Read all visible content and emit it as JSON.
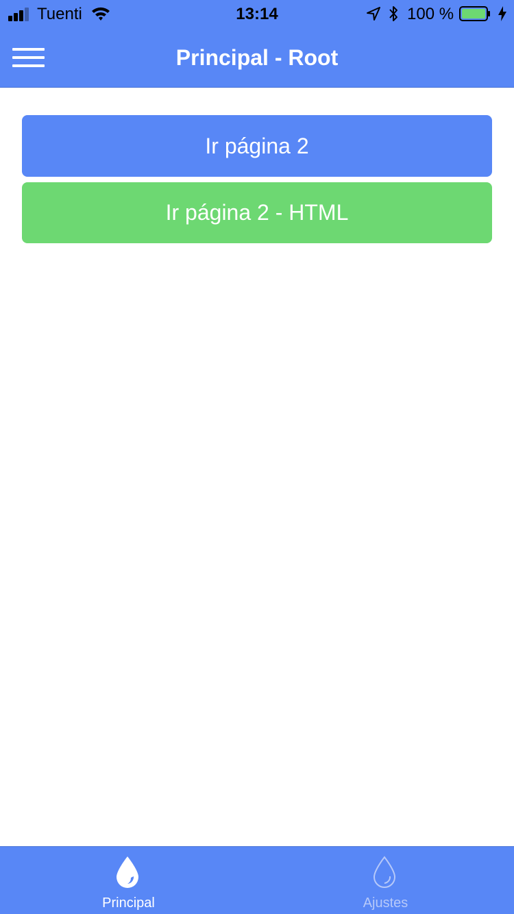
{
  "status_bar": {
    "carrier": "Tuenti",
    "time": "13:14",
    "battery_percent": "100 %"
  },
  "nav_bar": {
    "title": "Principal - Root",
    "menu_icon": "hamburger-icon"
  },
  "buttons": {
    "page2_label": "Ir página 2",
    "page2_html_label": "Ir página 2 - HTML"
  },
  "tab_bar": {
    "tabs": [
      {
        "label": "Principal",
        "icon": "water-drop-icon",
        "active": true
      },
      {
        "label": "Ajustes",
        "icon": "water-drop-outline-icon",
        "active": false
      }
    ]
  },
  "colors": {
    "primary": "#5887f6",
    "success": "#6dd872",
    "battery_fill": "#6dd872"
  }
}
